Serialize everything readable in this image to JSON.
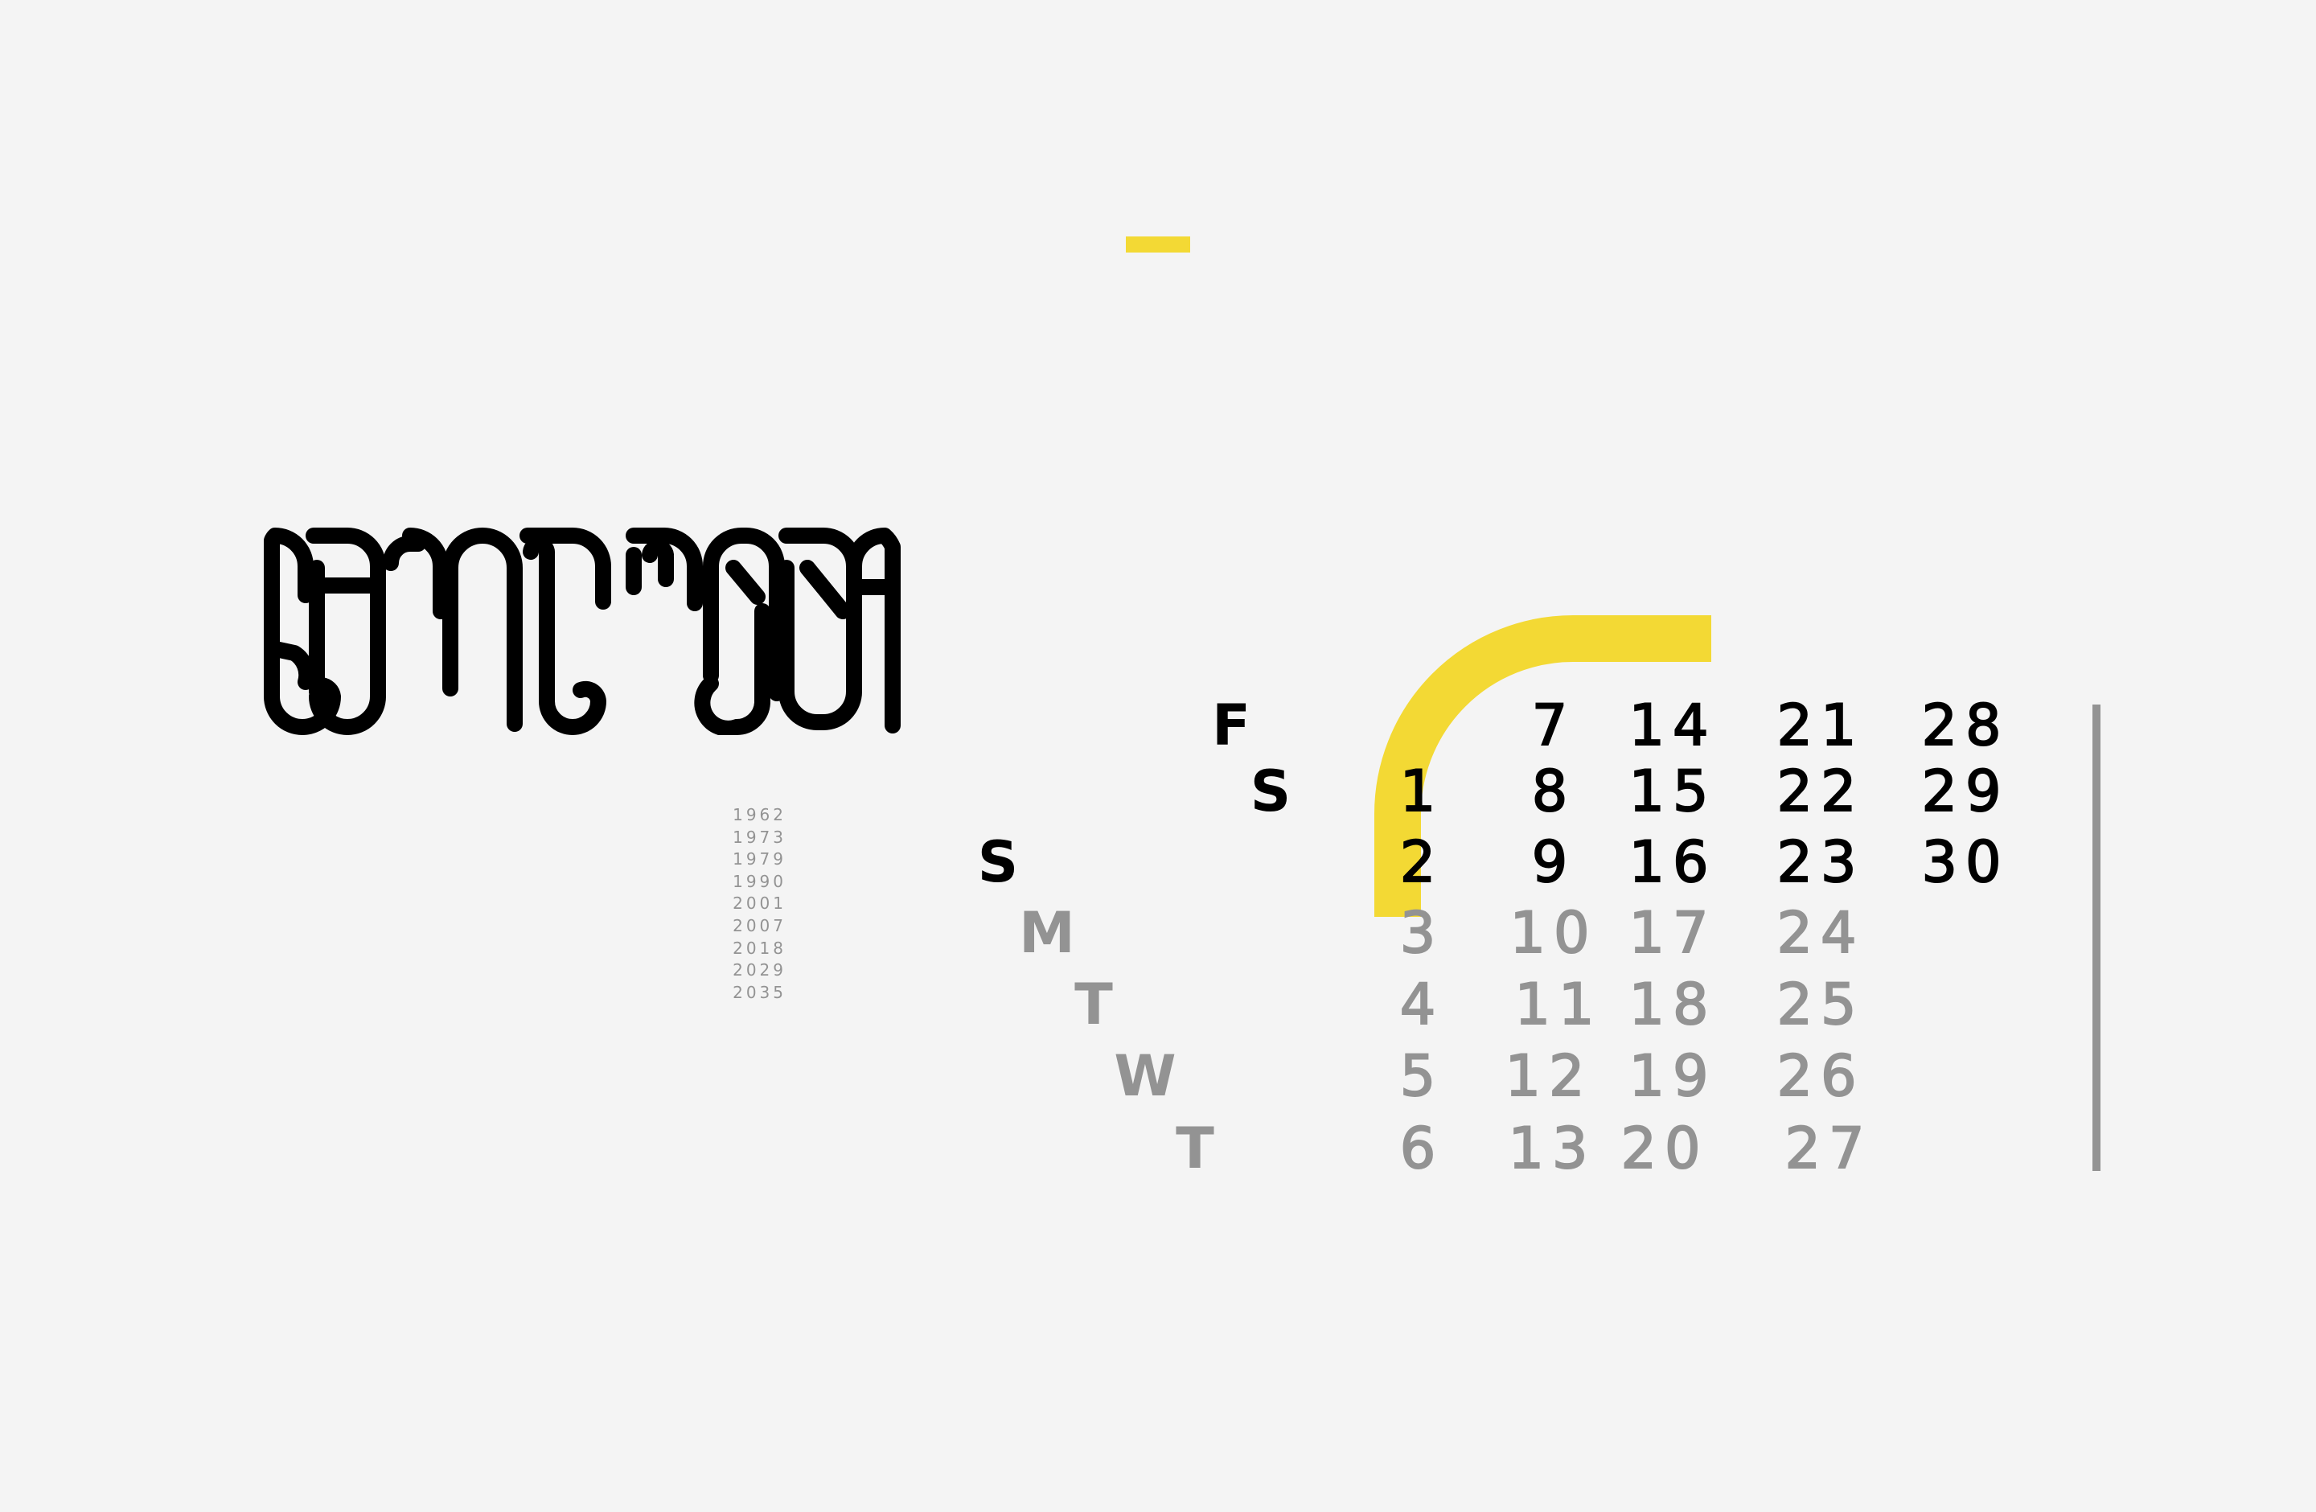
{
  "colors": {
    "background": "#f4f4f4",
    "accent_yellow": "#f3d934",
    "primary_text": "#000000",
    "secondary_text": "#939393",
    "title_stroke": "#000000"
  },
  "title_logo": {
    "text": "SEPTEMBER",
    "style": "stylized-monoline-lettering"
  },
  "years": [
    "1962",
    "1973",
    "1979",
    "1990",
    "2001",
    "2007",
    "2018",
    "2029",
    "2035"
  ],
  "calendar": {
    "rows": [
      {
        "day": "F",
        "dates": [
          "7",
          "14",
          "21",
          "28"
        ]
      },
      {
        "day": "S",
        "dates": [
          "1",
          "8",
          "15",
          "22",
          "29"
        ]
      },
      {
        "day": "S",
        "dates": [
          "2",
          "9",
          "16",
          "23",
          "30"
        ]
      },
      {
        "day": "M",
        "dates": [
          "3",
          "10",
          "17",
          "24"
        ]
      },
      {
        "day": "T",
        "dates": [
          "4",
          "11",
          "18",
          "25"
        ]
      },
      {
        "day": "W",
        "dates": [
          "5",
          "12",
          "19",
          "26"
        ]
      },
      {
        "day": "T",
        "dates": [
          "6",
          "13",
          "20",
          "27"
        ]
      }
    ]
  }
}
